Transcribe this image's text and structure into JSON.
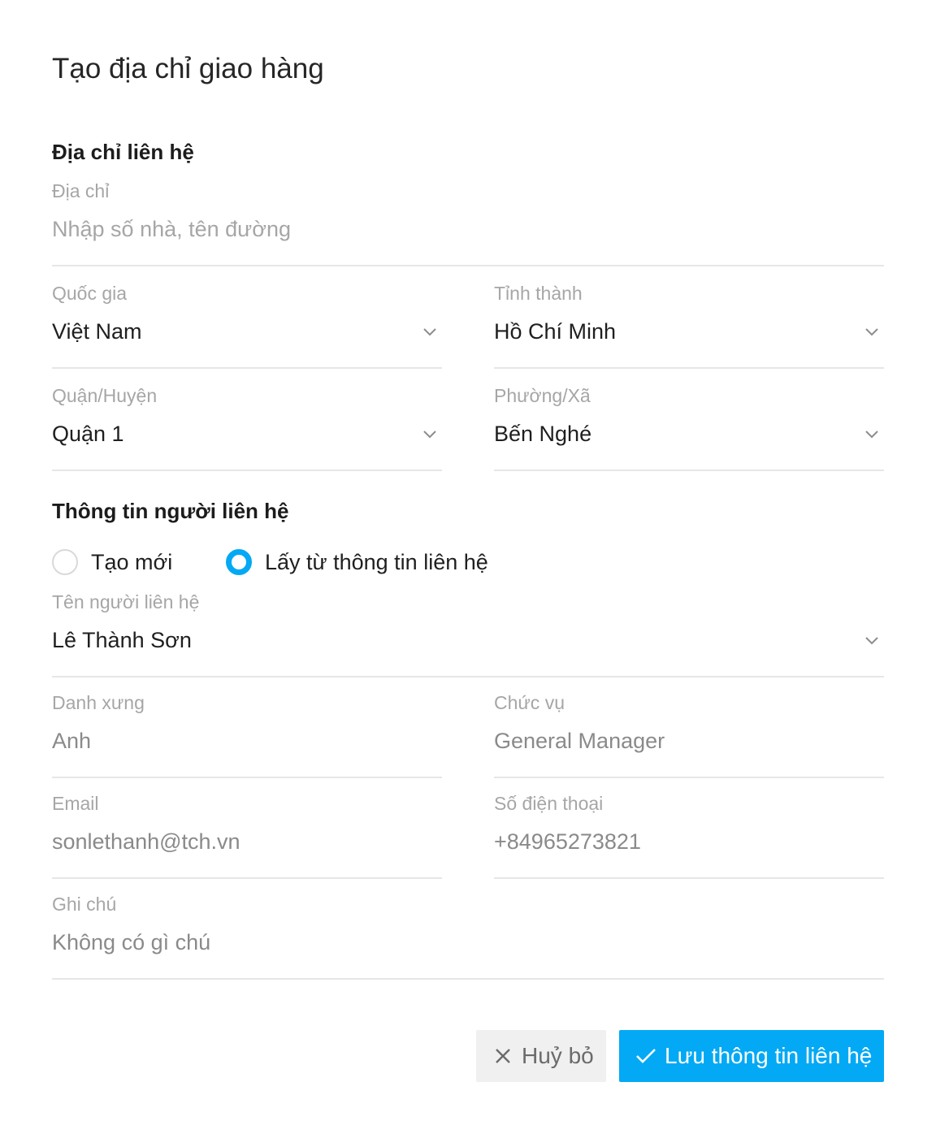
{
  "dialog": {
    "title": "Tạo địa chỉ giao hàng"
  },
  "address_section": {
    "title": "Địa chỉ liên hệ",
    "address": {
      "label": "Địa chỉ",
      "placeholder": "Nhập số nhà, tên đường",
      "value": ""
    },
    "country": {
      "label": "Quốc gia",
      "value": "Việt Nam"
    },
    "province": {
      "label": "Tỉnh thành",
      "value": "Hồ Chí Minh"
    },
    "district": {
      "label": "Quận/Huyện",
      "value": "Quận 1"
    },
    "ward": {
      "label": "Phường/Xã",
      "value": "Bến Nghé"
    }
  },
  "contact_section": {
    "title": "Thông tin người liên hệ",
    "radio_options": [
      {
        "label": "Tạo mới",
        "selected": false
      },
      {
        "label": "Lấy từ thông tin liên hệ",
        "selected": true
      }
    ],
    "contact_name": {
      "label": "Tên người liên hệ",
      "value": "Lê Thành Sơn"
    },
    "salutation": {
      "label": "Danh xưng",
      "value": "Anh"
    },
    "position": {
      "label": "Chức vụ",
      "value": "General Manager"
    },
    "email": {
      "label": "Email",
      "value": "sonlethanh@tch.vn"
    },
    "phone": {
      "label": "Số điện thoại",
      "value": "+84965273821"
    },
    "note": {
      "label": "Ghi chú",
      "value": "Không có gì chú"
    }
  },
  "actions": {
    "cancel_label": "Huỷ bỏ",
    "save_label": "Lưu thông tin liên hệ"
  },
  "colors": {
    "accent": "#03a9f4",
    "label_gray": "#a6a6a6",
    "divider": "#e6e6e6",
    "cancel_bg": "#f0f0f0"
  },
  "icons": {
    "dropdown": "chevron-down-icon",
    "cancel": "close-icon",
    "save": "check-icon"
  }
}
